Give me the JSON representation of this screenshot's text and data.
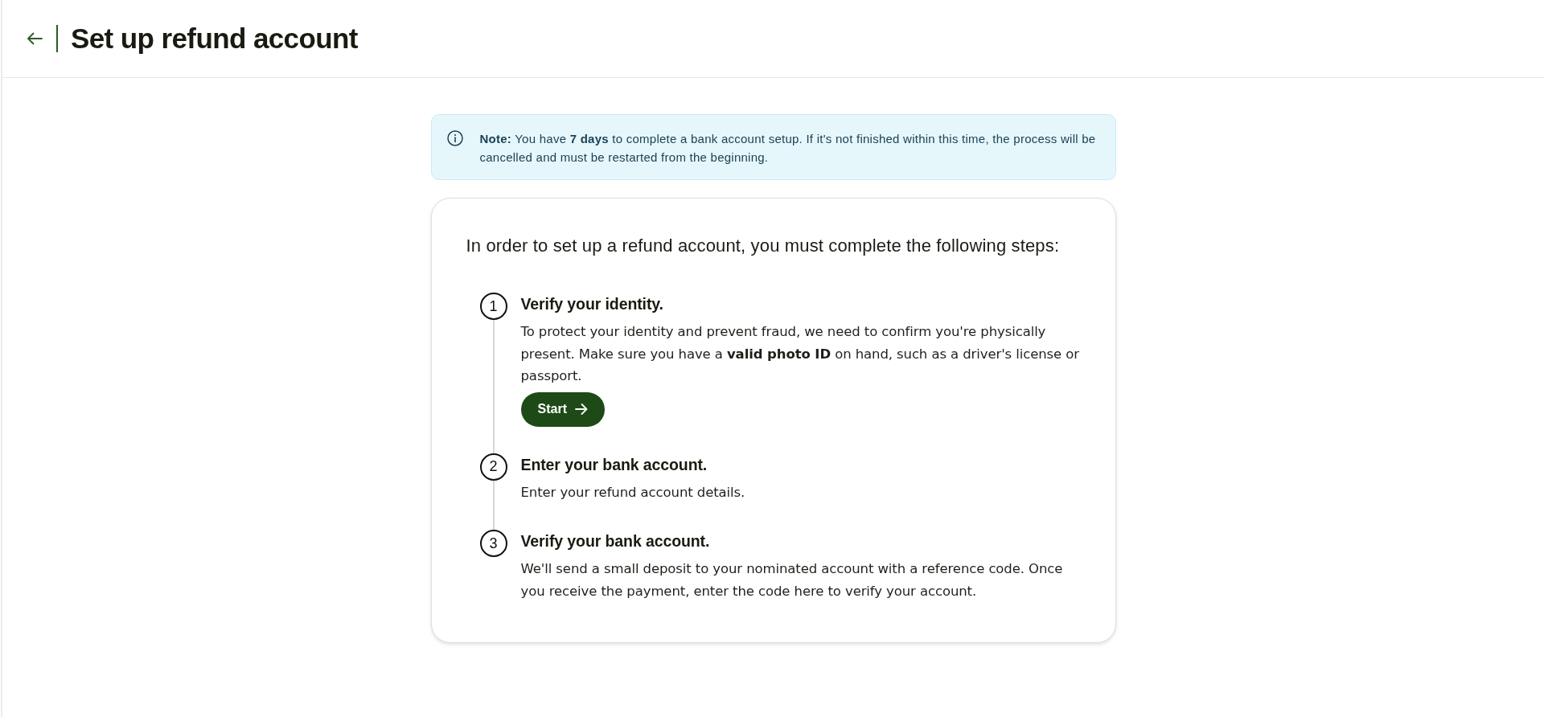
{
  "header": {
    "title": "Set up refund account"
  },
  "note": {
    "text": "**Note:** You have **7 days** to complete a bank account setup. If it's not finished within this time, the process will be cancelled and must be restarted from the beginning."
  },
  "card": {
    "intro": "In order to set up a refund account, you must complete the following steps:",
    "steps": [
      {
        "number": "1",
        "title": "Verify your identity.",
        "description": "To protect your identity and prevent fraud, we need to confirm you're physically present. Make sure you have a **valid photo ID** on hand, such as a driver's license or passport.",
        "button": {
          "label": "Start"
        }
      },
      {
        "number": "2",
        "title": "Enter your bank account.",
        "description": "Enter your refund account details."
      },
      {
        "number": "3",
        "title": "Verify your bank account.",
        "description": "We'll send a small deposit to your nominated account with a reference code. Once you receive the payment, enter the code here to verify your account."
      }
    ]
  }
}
